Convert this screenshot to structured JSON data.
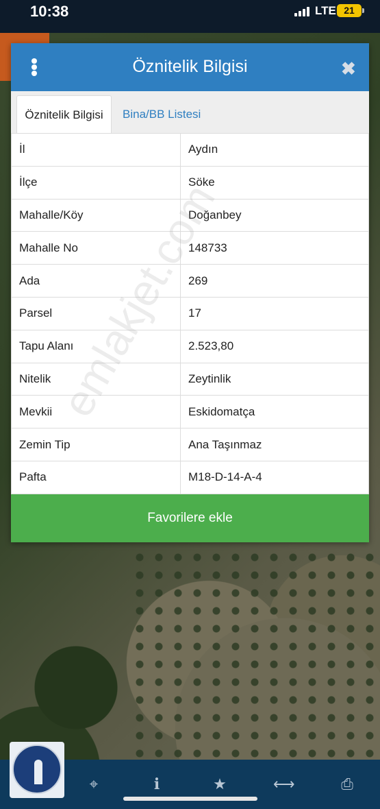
{
  "status_bar": {
    "time": "10:38",
    "network": "LTE",
    "battery": "21"
  },
  "dialog": {
    "title": "Öznitelik Bilgisi",
    "tabs": [
      {
        "label": "Öznitelik Bilgisi",
        "active": true
      },
      {
        "label": "Bina/BB Listesi",
        "active": false
      }
    ],
    "rows": [
      {
        "key": "İl",
        "value": "Aydın"
      },
      {
        "key": "İlçe",
        "value": "Söke"
      },
      {
        "key": "Mahalle/Köy",
        "value": "Doğanbey"
      },
      {
        "key": "Mahalle No",
        "value": "148733"
      },
      {
        "key": "Ada",
        "value": "269"
      },
      {
        "key": "Parsel",
        "value": "17"
      },
      {
        "key": "Tapu Alanı",
        "value": "2.523,80"
      },
      {
        "key": "Nitelik",
        "value": "Zeytinlik"
      },
      {
        "key": "Mevkii",
        "value": "Eskidomatça"
      },
      {
        "key": "Zemin Tip",
        "value": "Ana Taşınmaz"
      },
      {
        "key": "Pafta",
        "value": "M18-D-14-A-4"
      }
    ],
    "favorite_button": "Favorilere ekle"
  },
  "watermark": "emlakjet.com",
  "bottom_toolbar": {
    "icons": [
      "locate-icon",
      "info-icon",
      "star-icon",
      "measure-icon",
      "print-icon"
    ]
  },
  "colors": {
    "header": "#2f7fc1",
    "tab_link": "#2f7fc1",
    "favorite": "#4cae4c",
    "toolbar": "#0e3a5c"
  }
}
